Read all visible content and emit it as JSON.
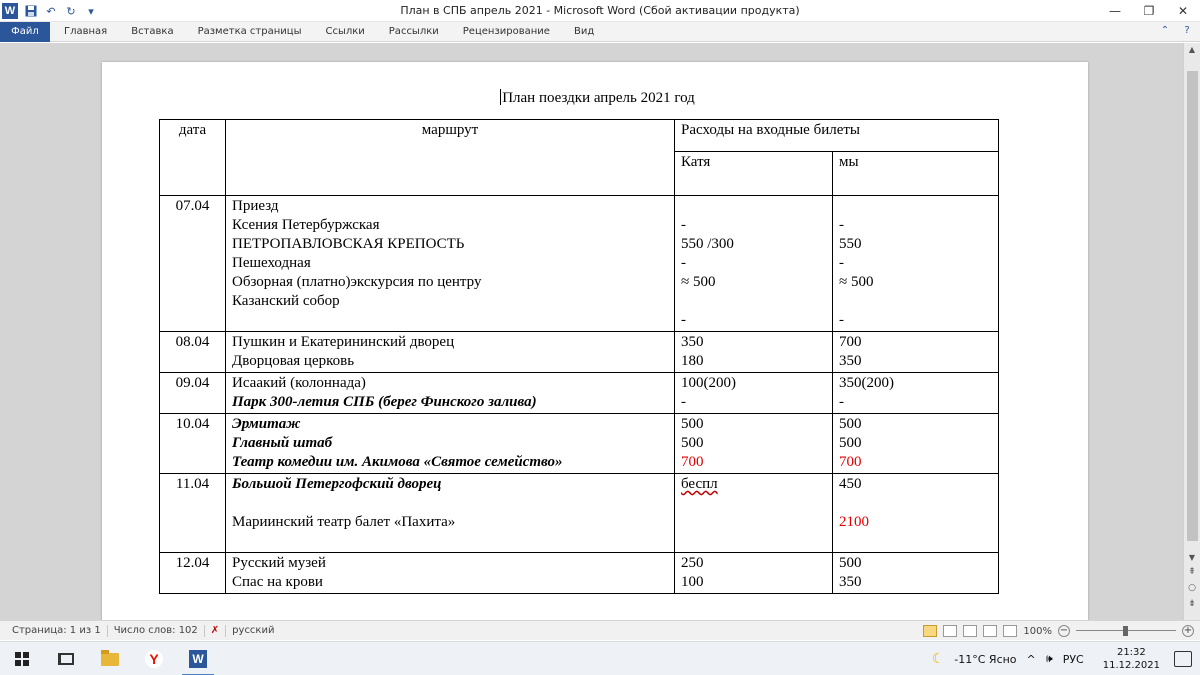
{
  "window": {
    "app_logo": "W",
    "title": "План в СПБ апрель 2021  -  Microsoft Word (Сбой активации продукта)"
  },
  "ribbon": {
    "file_tab": "Файл",
    "tabs": [
      "Главная",
      "Вставка",
      "Разметка страницы",
      "Ссылки",
      "Рассылки",
      "Рецензирование",
      "Вид"
    ]
  },
  "document": {
    "title": "План поездки апрель 2021 год",
    "headers": {
      "date": "дата",
      "route": "маршрут",
      "expenses": "Расходы на входные билеты",
      "katya": "Катя",
      "we": "мы"
    },
    "rows": [
      {
        "date": "07.04",
        "lines": [
          {
            "route": "Приезд",
            "katya": "",
            "we": ""
          },
          {
            "route": "Ксения Петербуржская",
            "katya": "-",
            "we": "-"
          },
          {
            "route": "ПЕТРОПАВЛОВСКАЯ КРЕПОСТЬ",
            "katya": "550 /300",
            "we": "550"
          },
          {
            "route": "Пешеходная",
            "katya": "-",
            "we": "-"
          },
          {
            "route": "Обзорная (платно)экскурсия по центру",
            "katya": "≈  500",
            "we": "≈  500"
          },
          {
            "route": "Казанский собор",
            "katya": "",
            "we": ""
          },
          {
            "route": "",
            "katya": "-",
            "we": "-"
          }
        ]
      },
      {
        "date": "08.04",
        "lines": [
          {
            "route": "Пушкин и Екатерининский дворец",
            "katya": " 350",
            "we": "700"
          },
          {
            "route": "Дворцовая церковь",
            "katya": "180",
            "we": "350"
          }
        ]
      },
      {
        "date": "09.04",
        "lines": [
          {
            "route": "Исаакий (колоннада)",
            "katya": "100(200)",
            "we": "350(200)"
          },
          {
            "route": "Парк 300-летия СПБ (берег Финского залива)",
            "katya": "-",
            "we": "-",
            "bold": true
          }
        ]
      },
      {
        "date": "10.04",
        "lines": [
          {
            "route": "Эрмитаж",
            "katya": "500",
            "we": "500",
            "bold": true
          },
          {
            "route": "Главный штаб",
            "katya": "500",
            "we": "500",
            "bold": true
          },
          {
            "route": "Театр комедии  им. Акимова «Святое семейство»",
            "katya": "700",
            "we": "700",
            "bold": true,
            "red": true
          }
        ]
      },
      {
        "date": "11.04",
        "lines": [
          {
            "route": "Большой Петергофский дворец",
            "katya": "беспл",
            "we": "450",
            "bold": true,
            "wavy": true
          },
          {
            "route": "",
            "katya": "",
            "we": ""
          },
          {
            "route": "Мариинский театр балет «Пахита»",
            "katya": "",
            "we": "2100",
            "red": true
          },
          {
            "route": "",
            "katya": "",
            "we": ""
          }
        ]
      },
      {
        "date": "12.04",
        "lines": [
          {
            "route": "Русский музей",
            "katya": "250",
            "we": "500"
          },
          {
            "route": "Спас на крови",
            "katya": "100",
            "we": "350"
          }
        ]
      }
    ]
  },
  "status": {
    "page": "Страница: 1 из 1",
    "words": "Число слов: 102",
    "language": "русский",
    "zoom": "100%"
  },
  "taskbar": {
    "weather": "-11°C  Ясно",
    "lang": "РУС",
    "time": "21:32",
    "date": "11.12.2021"
  }
}
